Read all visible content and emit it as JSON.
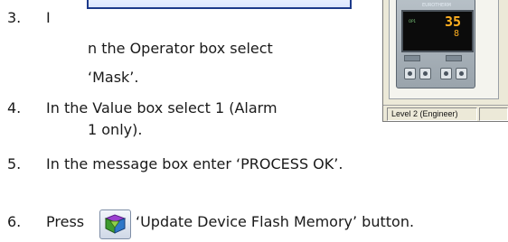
{
  "steps": [
    {
      "num": "3.",
      "lead": "I",
      "line1": "n the Operator box select",
      "line2": "‘Mask’."
    },
    {
      "num": "4.",
      "line1": "In the Value box select 1 (Alarm",
      "line2": "1 only)."
    },
    {
      "num": "5.",
      "line1": "In the message box enter ‘PROCESS OK’."
    },
    {
      "num": "6.",
      "before": "Press",
      "after": "‘Update Device Flash Memory’ button."
    }
  ],
  "thumbnail": {
    "brand": "EUROTHERM",
    "pv": "35",
    "sp": "8",
    "op_label": "OP1",
    "status": "Level 2 (Engineer)"
  },
  "icons": {
    "flash": "update-flash-memory-icon"
  }
}
